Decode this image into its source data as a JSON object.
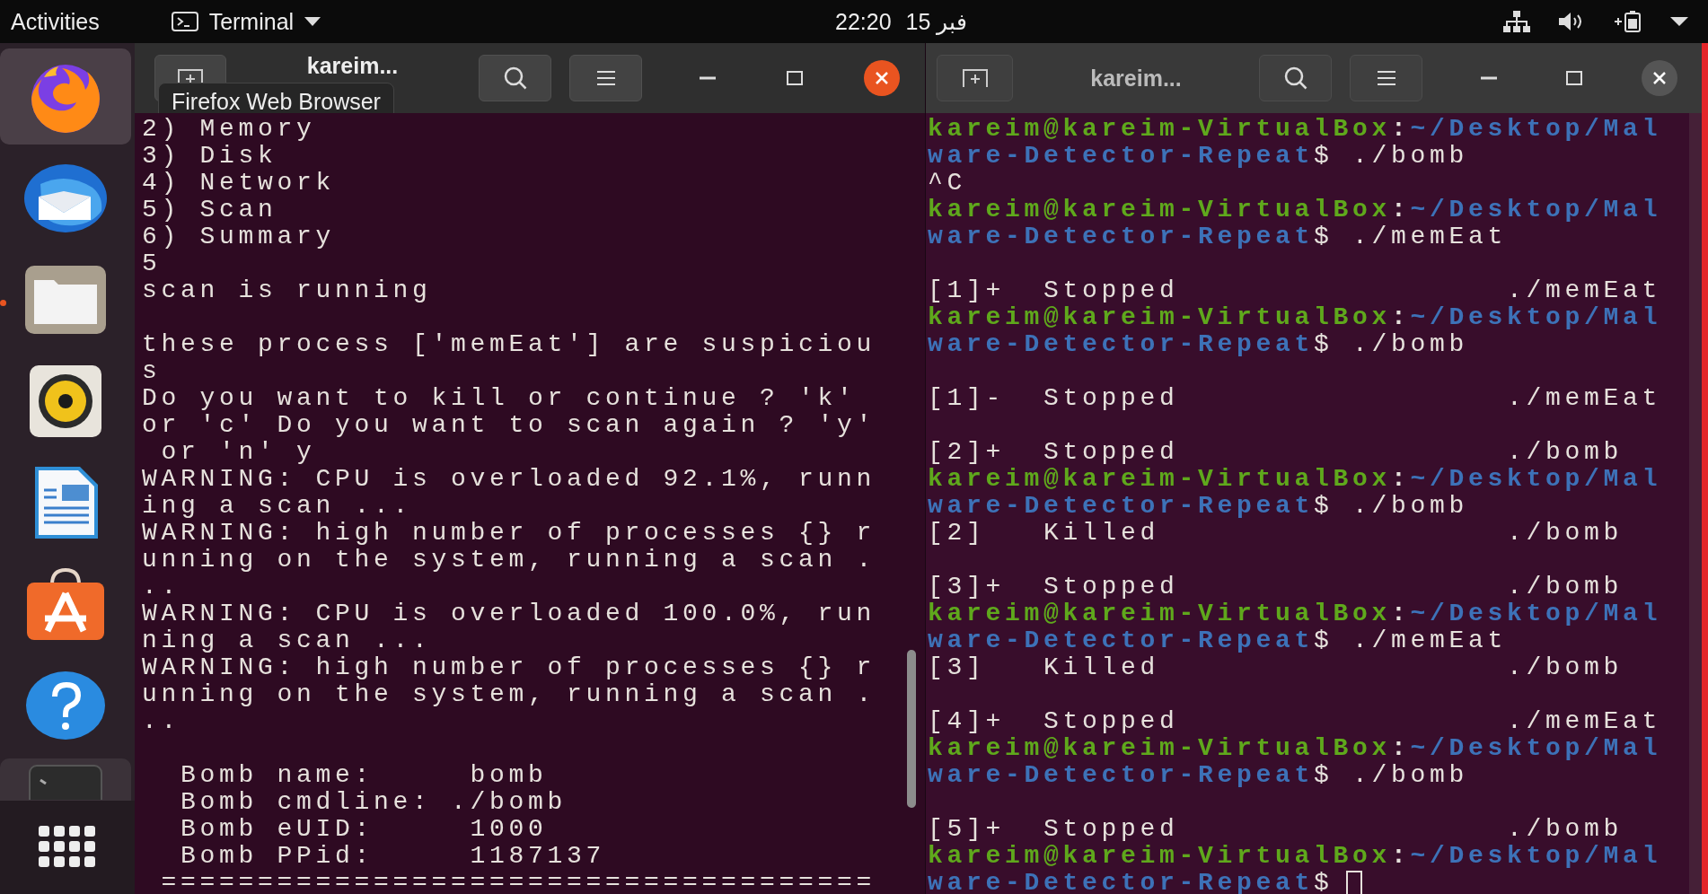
{
  "top_bar": {
    "activities": "Activities",
    "app_menu": "Terminal",
    "time": "22:20",
    "date": "15 فبر"
  },
  "dock": {
    "items": [
      {
        "kind": "firefox",
        "hovered": true,
        "running": false
      },
      {
        "kind": "thunderbird",
        "hovered": false,
        "running": false
      },
      {
        "kind": "files",
        "hovered": false,
        "running": true
      },
      {
        "kind": "rhythmbox",
        "hovered": false,
        "running": false
      },
      {
        "kind": "writer",
        "hovered": false,
        "running": false
      },
      {
        "kind": "software",
        "hovered": false,
        "running": false
      },
      {
        "kind": "help",
        "hovered": false,
        "running": false
      },
      {
        "kind": "terminal",
        "hovered": false,
        "running": false
      }
    ],
    "tooltip": "Firefox Web Browser"
  },
  "terminals": [
    {
      "title": "kareim...",
      "focused": true,
      "lines": [
        {
          "kind": "output",
          "text": "2) Memory"
        },
        {
          "kind": "output",
          "text": "3) Disk"
        },
        {
          "kind": "output",
          "text": "4) Network"
        },
        {
          "kind": "output",
          "text": "5) Scan"
        },
        {
          "kind": "output",
          "text": "6) Summary"
        },
        {
          "kind": "output",
          "text": "5"
        },
        {
          "kind": "output",
          "text": "scan is running"
        },
        {
          "kind": "blank"
        },
        {
          "kind": "output",
          "text": "these process ['memEat'] are suspiciou"
        },
        {
          "kind": "output",
          "text": "s"
        },
        {
          "kind": "output",
          "text": "Do you want to kill or continue ? 'k'"
        },
        {
          "kind": "output",
          "text": "or 'c' Do you want to scan again ? 'y'"
        },
        {
          "kind": "output",
          "text": " or 'n' y"
        },
        {
          "kind": "output",
          "text": "WARNING: CPU is overloaded 92.1%, runn"
        },
        {
          "kind": "output",
          "text": "ing a scan ..."
        },
        {
          "kind": "output",
          "text": "WARNING: high number of processes {} r"
        },
        {
          "kind": "output",
          "text": "unning on the system, running a scan ."
        },
        {
          "kind": "output",
          "text": ".."
        },
        {
          "kind": "output",
          "text": "WARNING: CPU is overloaded 100.0%, run"
        },
        {
          "kind": "output",
          "text": "ning a scan ..."
        },
        {
          "kind": "output",
          "text": "WARNING: high number of processes {} r"
        },
        {
          "kind": "output",
          "text": "unning on the system, running a scan ."
        },
        {
          "kind": "output",
          "text": ".."
        },
        {
          "kind": "blank"
        },
        {
          "kind": "output",
          "text": "  Bomb name:     bomb"
        },
        {
          "kind": "output",
          "text": "  Bomb cmdline: ./bomb"
        },
        {
          "kind": "output",
          "text": "  Bomb eUID:     1000"
        },
        {
          "kind": "output",
          "text": "  Bomb PPid:     1187137"
        },
        {
          "kind": "output",
          "text": " ====================================="
        }
      ]
    },
    {
      "title": "kareim...",
      "focused": false,
      "lines": [
        {
          "kind": "prompt",
          "user": "kareim@kareim-VirtualBox",
          "colon": ":",
          "path": "~/Desktop/Malware-Detector-Repeat",
          "sign": "$",
          "command": "./bomb"
        },
        {
          "kind": "output",
          "text": "^C"
        },
        {
          "kind": "prompt",
          "user": "kareim@kareim-VirtualBox",
          "colon": ":",
          "path": "~/Desktop/Malware-Detector-Repeat",
          "sign": "$",
          "command": "./memEat"
        },
        {
          "kind": "blank"
        },
        {
          "kind": "job",
          "job": "[1]+",
          "status": "Stopped",
          "command": "./memEat"
        },
        {
          "kind": "prompt",
          "user": "kareim@kareim-VirtualBox",
          "colon": ":",
          "path": "~/Desktop/Malware-Detector-Repeat",
          "sign": "$",
          "command": "./bomb"
        },
        {
          "kind": "blank"
        },
        {
          "kind": "job",
          "job": "[1]-",
          "status": "Stopped",
          "command": "./memEat"
        },
        {
          "kind": "blank"
        },
        {
          "kind": "job",
          "job": "[2]+",
          "status": "Stopped",
          "command": "./bomb"
        },
        {
          "kind": "prompt",
          "user": "kareim@kareim-VirtualBox",
          "colon": ":",
          "path": "~/Desktop/Malware-Detector-Repeat",
          "sign": "$",
          "command": "./bomb"
        },
        {
          "kind": "job",
          "job": "[2]",
          "status": "Killed",
          "command": "./bomb"
        },
        {
          "kind": "blank"
        },
        {
          "kind": "job",
          "job": "[3]+",
          "status": "Stopped",
          "command": "./bomb"
        },
        {
          "kind": "prompt",
          "user": "kareim@kareim-VirtualBox",
          "colon": ":",
          "path": "~/Desktop/Malware-Detector-Repeat",
          "sign": "$",
          "command": "./memEat"
        },
        {
          "kind": "job",
          "job": "[3]",
          "status": "Killed",
          "command": "./bomb"
        },
        {
          "kind": "blank"
        },
        {
          "kind": "job",
          "job": "[4]+",
          "status": "Stopped",
          "command": "./memEat"
        },
        {
          "kind": "prompt",
          "user": "kareim@kareim-VirtualBox",
          "colon": ":",
          "path": "~/Desktop/Malware-Detector-Repeat",
          "sign": "$",
          "command": "./bomb"
        },
        {
          "kind": "blank"
        },
        {
          "kind": "job",
          "job": "[5]+",
          "status": "Stopped",
          "command": "./bomb"
        },
        {
          "kind": "prompt",
          "user": "kareim@kareim-VirtualBox",
          "colon": ":",
          "path": "~/Desktop/Malware-Detector-Repeat",
          "sign": "$",
          "cursor": true
        }
      ]
    }
  ]
}
